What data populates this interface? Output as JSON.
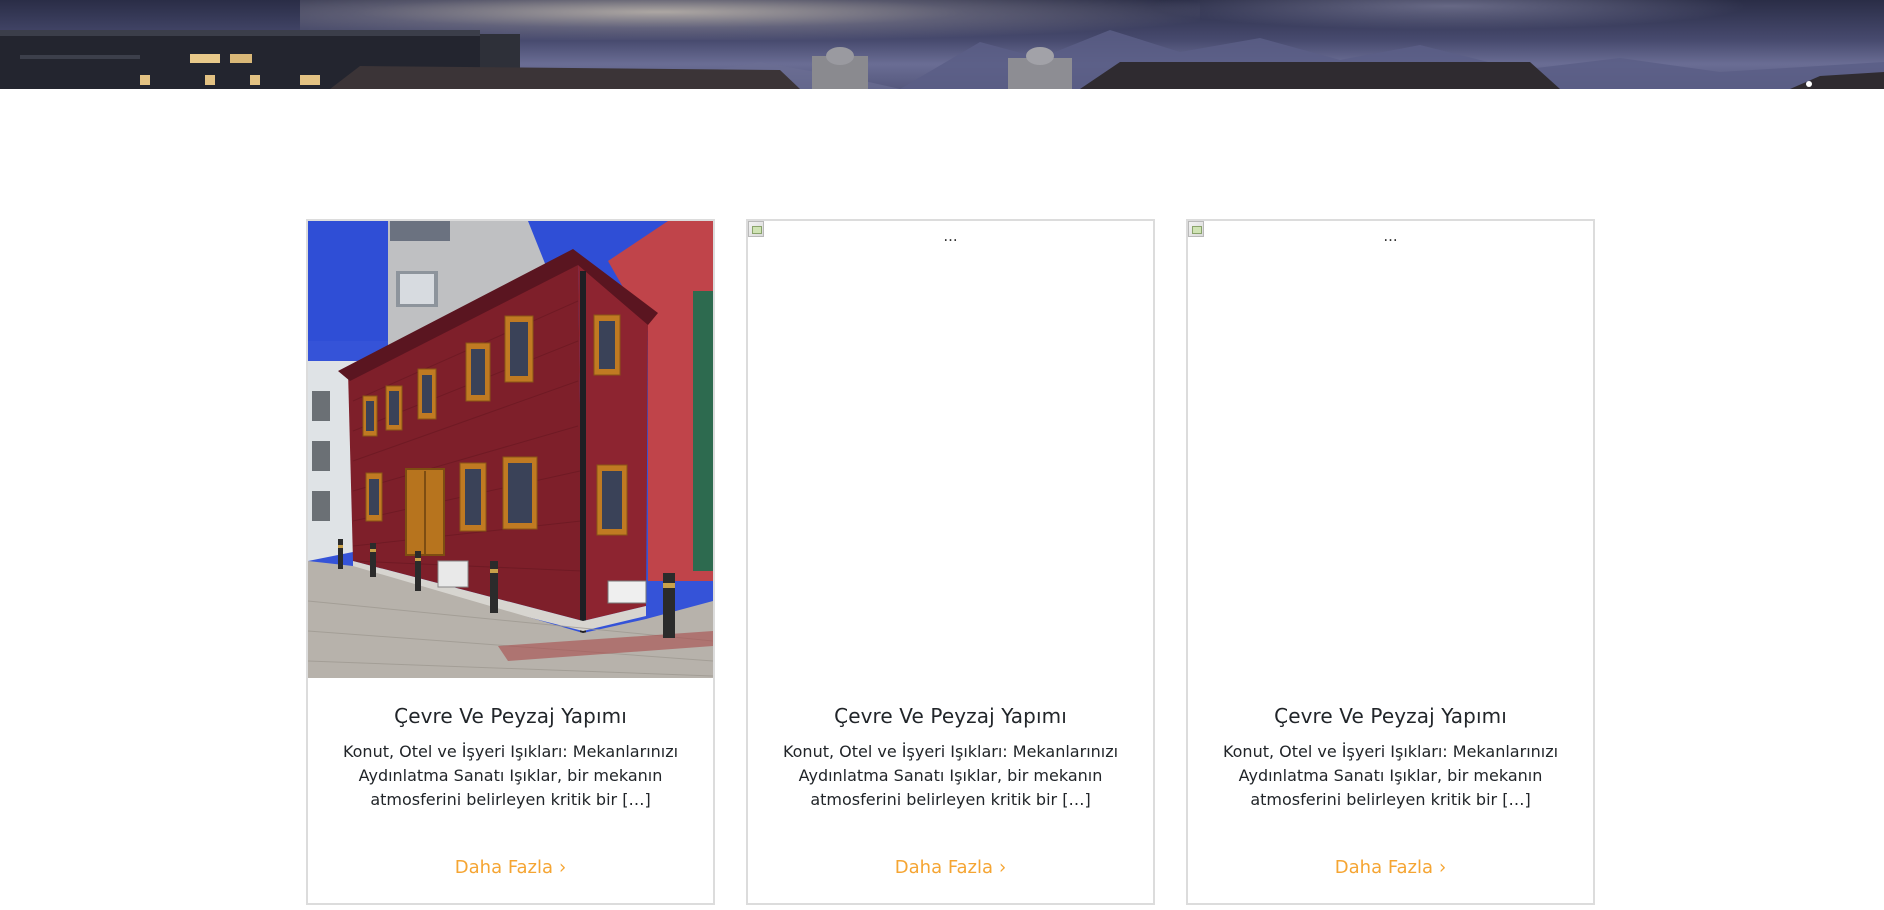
{
  "cards": [
    {
      "image": {
        "state": "loaded",
        "alt": "..."
      },
      "title": "Çevre Ve Peyzaj Yapımı",
      "text": "Konut, Otel ve İşyeri Işıkları: Mekanlarınızı Aydınlatma Sanatı Işıklar, bir mekanın atmosferini belirleyen kritik bir […]",
      "link_label": "Daha Fazla",
      "link_icon": "chevron-right-icon"
    },
    {
      "image": {
        "state": "broken",
        "alt": "..."
      },
      "title": "Çevre Ve Peyzaj Yapımı",
      "text": "Konut, Otel ve İşyeri Işıkları: Mekanlarınızı Aydınlatma Sanatı Işıklar, bir mekanın atmosferini belirleyen kritik bir […]",
      "link_label": "Daha Fazla",
      "link_icon": "chevron-right-icon"
    },
    {
      "image": {
        "state": "broken",
        "alt": "..."
      },
      "title": "Çevre Ve Peyzaj Yapımı",
      "text": "Konut, Otel ve İşyeri Işıkları: Mekanlarınızı Aydınlatma Sanatı Işıklar, bir mekanın atmosferini belirleyen kritik bir […]",
      "link_label": "Daha Fazla",
      "link_icon": "chevron-right-icon"
    }
  ],
  "colors": {
    "link_accent": "#f5a533",
    "card_border": "#dcdcdc",
    "text": "#212529"
  }
}
